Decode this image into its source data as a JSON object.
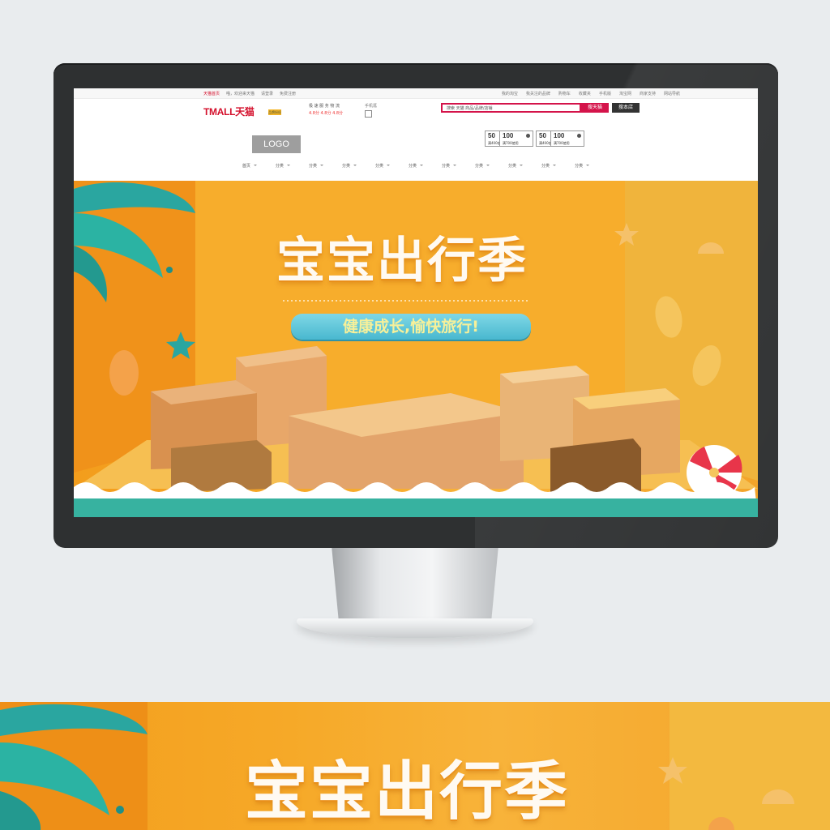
{
  "topbar": {
    "left": [
      "天猫首页",
      "喵，欢迎来天猫",
      "请登录",
      "免费注册"
    ],
    "right": [
      "我的淘宝",
      "我关注的品牌",
      "购物车",
      "收藏夹",
      "手机版",
      "淘宝网",
      "商家支持",
      "网站导航"
    ]
  },
  "header": {
    "brand": "TMALL天猫",
    "badge": "品牌授权",
    "promise_title": "极 速 服 务 物 流",
    "promise_sub": "4.8分  4.8分  4.8分",
    "mobile_label": "手机逛",
    "search_placeholder": "搜索 天猫 商品/品牌/店铺",
    "search_button": "搜天猫",
    "shop_button": "搜本店",
    "logo": "LOGO"
  },
  "coupons": [
    {
      "amount": "50",
      "condition": "满400使用"
    },
    {
      "amount": "100",
      "condition": "满700使用"
    },
    {
      "amount": "50",
      "condition": "满400使用"
    },
    {
      "amount": "100",
      "condition": "满700使用"
    }
  ],
  "nav": [
    "首页",
    "分类",
    "分类",
    "分类",
    "分类",
    "分类",
    "分类",
    "分类",
    "分类",
    "分类",
    "分类"
  ],
  "banner": {
    "title": "宝宝出行季",
    "subtitle": "健康成长,愉快旅行!"
  },
  "colors": {
    "brand": "#d4102c",
    "search": "#d4134a",
    "banner_orange": "#f6a928",
    "teal": "#2bb3a3",
    "pill": "#49b8cf"
  }
}
